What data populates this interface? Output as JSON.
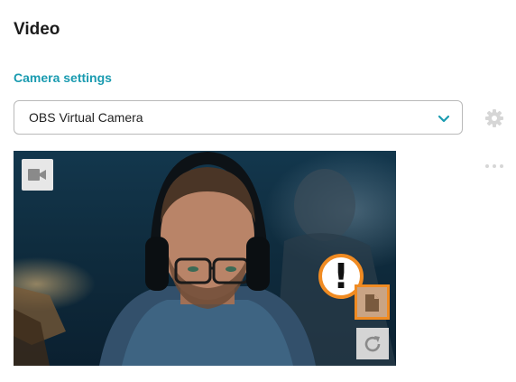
{
  "page": {
    "title": "Video"
  },
  "camera_settings": {
    "link_label": "Camera settings",
    "selected_camera": "OBS Virtual Camera"
  },
  "icons": {
    "settings": "gear-icon",
    "more": "more-dots-icon",
    "camera_toggle": "video-camera-icon",
    "file": "file-icon",
    "refresh": "refresh-icon",
    "warning": "exclamation-icon",
    "chevron": "chevron-down-icon"
  },
  "warning": {
    "symbol": "!"
  },
  "colors": {
    "accent": "#1a9bb0",
    "warning_orange": "#f08b22",
    "title_text": "#1c1c1c"
  }
}
